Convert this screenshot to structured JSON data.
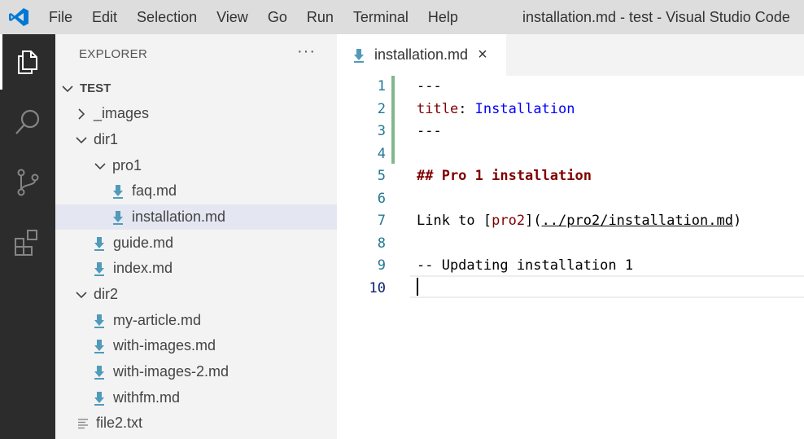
{
  "window": {
    "title": "installation.md - test - Visual Studio Code",
    "menu": [
      "File",
      "Edit",
      "Selection",
      "View",
      "Go",
      "Run",
      "Terminal",
      "Help"
    ]
  },
  "activity_bar": {
    "items": [
      {
        "icon": "files-icon",
        "active": true
      },
      {
        "icon": "search-icon",
        "active": false
      },
      {
        "icon": "source-control-icon",
        "active": false
      },
      {
        "icon": "extensions-icon",
        "active": false
      }
    ]
  },
  "explorer": {
    "header": "EXPLORER",
    "more": "···",
    "root": "TEST",
    "tree": [
      {
        "label": "_images",
        "kind": "folder",
        "expanded": false
      },
      {
        "label": "dir1",
        "kind": "folder",
        "expanded": true
      },
      {
        "label": "pro1",
        "kind": "folder",
        "expanded": true
      },
      {
        "label": "faq.md",
        "kind": "markdown"
      },
      {
        "label": "installation.md",
        "kind": "markdown",
        "selected": true
      },
      {
        "label": "guide.md",
        "kind": "markdown"
      },
      {
        "label": "index.md",
        "kind": "markdown"
      },
      {
        "label": "dir2",
        "kind": "folder",
        "expanded": true
      },
      {
        "label": "my-article.md",
        "kind": "markdown"
      },
      {
        "label": "with-images.md",
        "kind": "markdown"
      },
      {
        "label": "with-images-2.md",
        "kind": "markdown"
      },
      {
        "label": "withfm.md",
        "kind": "markdown"
      },
      {
        "label": "file2.txt",
        "kind": "text"
      }
    ]
  },
  "editor": {
    "tab": {
      "label": "installation.md",
      "close": "×"
    },
    "line_numbers": [
      "1",
      "2",
      "3",
      "4",
      "5",
      "6",
      "7",
      "8",
      "9",
      "10"
    ],
    "lines": {
      "l1": "---",
      "l2_key": "title",
      "l2_sep": ": ",
      "l2_val": "Installation",
      "l3": "---",
      "l5": "## Pro 1 installation",
      "l7_pre": "Link to [",
      "l7_text": "pro2",
      "l7_mid": "](",
      "l7_url": "../pro2/installation.md",
      "l7_post": ")",
      "l9": "-- Updating installation 1"
    }
  },
  "colors": {
    "accent": "#0066b8",
    "md_icon": "#519aba",
    "line_number": "#237893",
    "frontmatter_key": "#800000",
    "frontmatter_value": "#0000ff",
    "gutter_added": "#81b88b"
  }
}
